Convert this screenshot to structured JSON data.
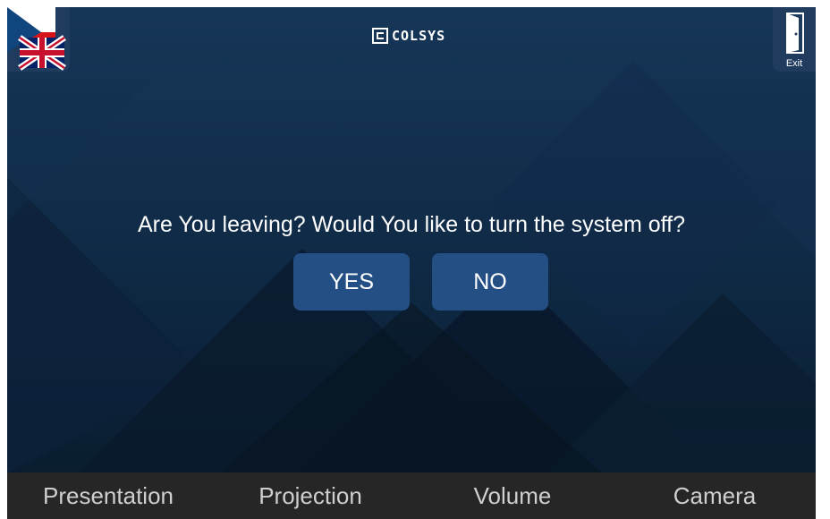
{
  "header": {
    "brand_text": "COLSYS",
    "exit_label": "Exit",
    "language_icon": "flag-cz-gb-icon",
    "exit_icon": "door-exit-icon"
  },
  "dialog": {
    "question": "Are You leaving? Would You like to turn the system off?",
    "yes_label": "YES",
    "no_label": "NO"
  },
  "nav": {
    "items": [
      {
        "label": "Presentation"
      },
      {
        "label": "Projection"
      },
      {
        "label": "Volume"
      },
      {
        "label": "Camera"
      }
    ]
  },
  "colors": {
    "background": "#0f2a45",
    "button": "#244f85",
    "nav_bar": "#262626",
    "nav_text": "#cfcfcf"
  }
}
